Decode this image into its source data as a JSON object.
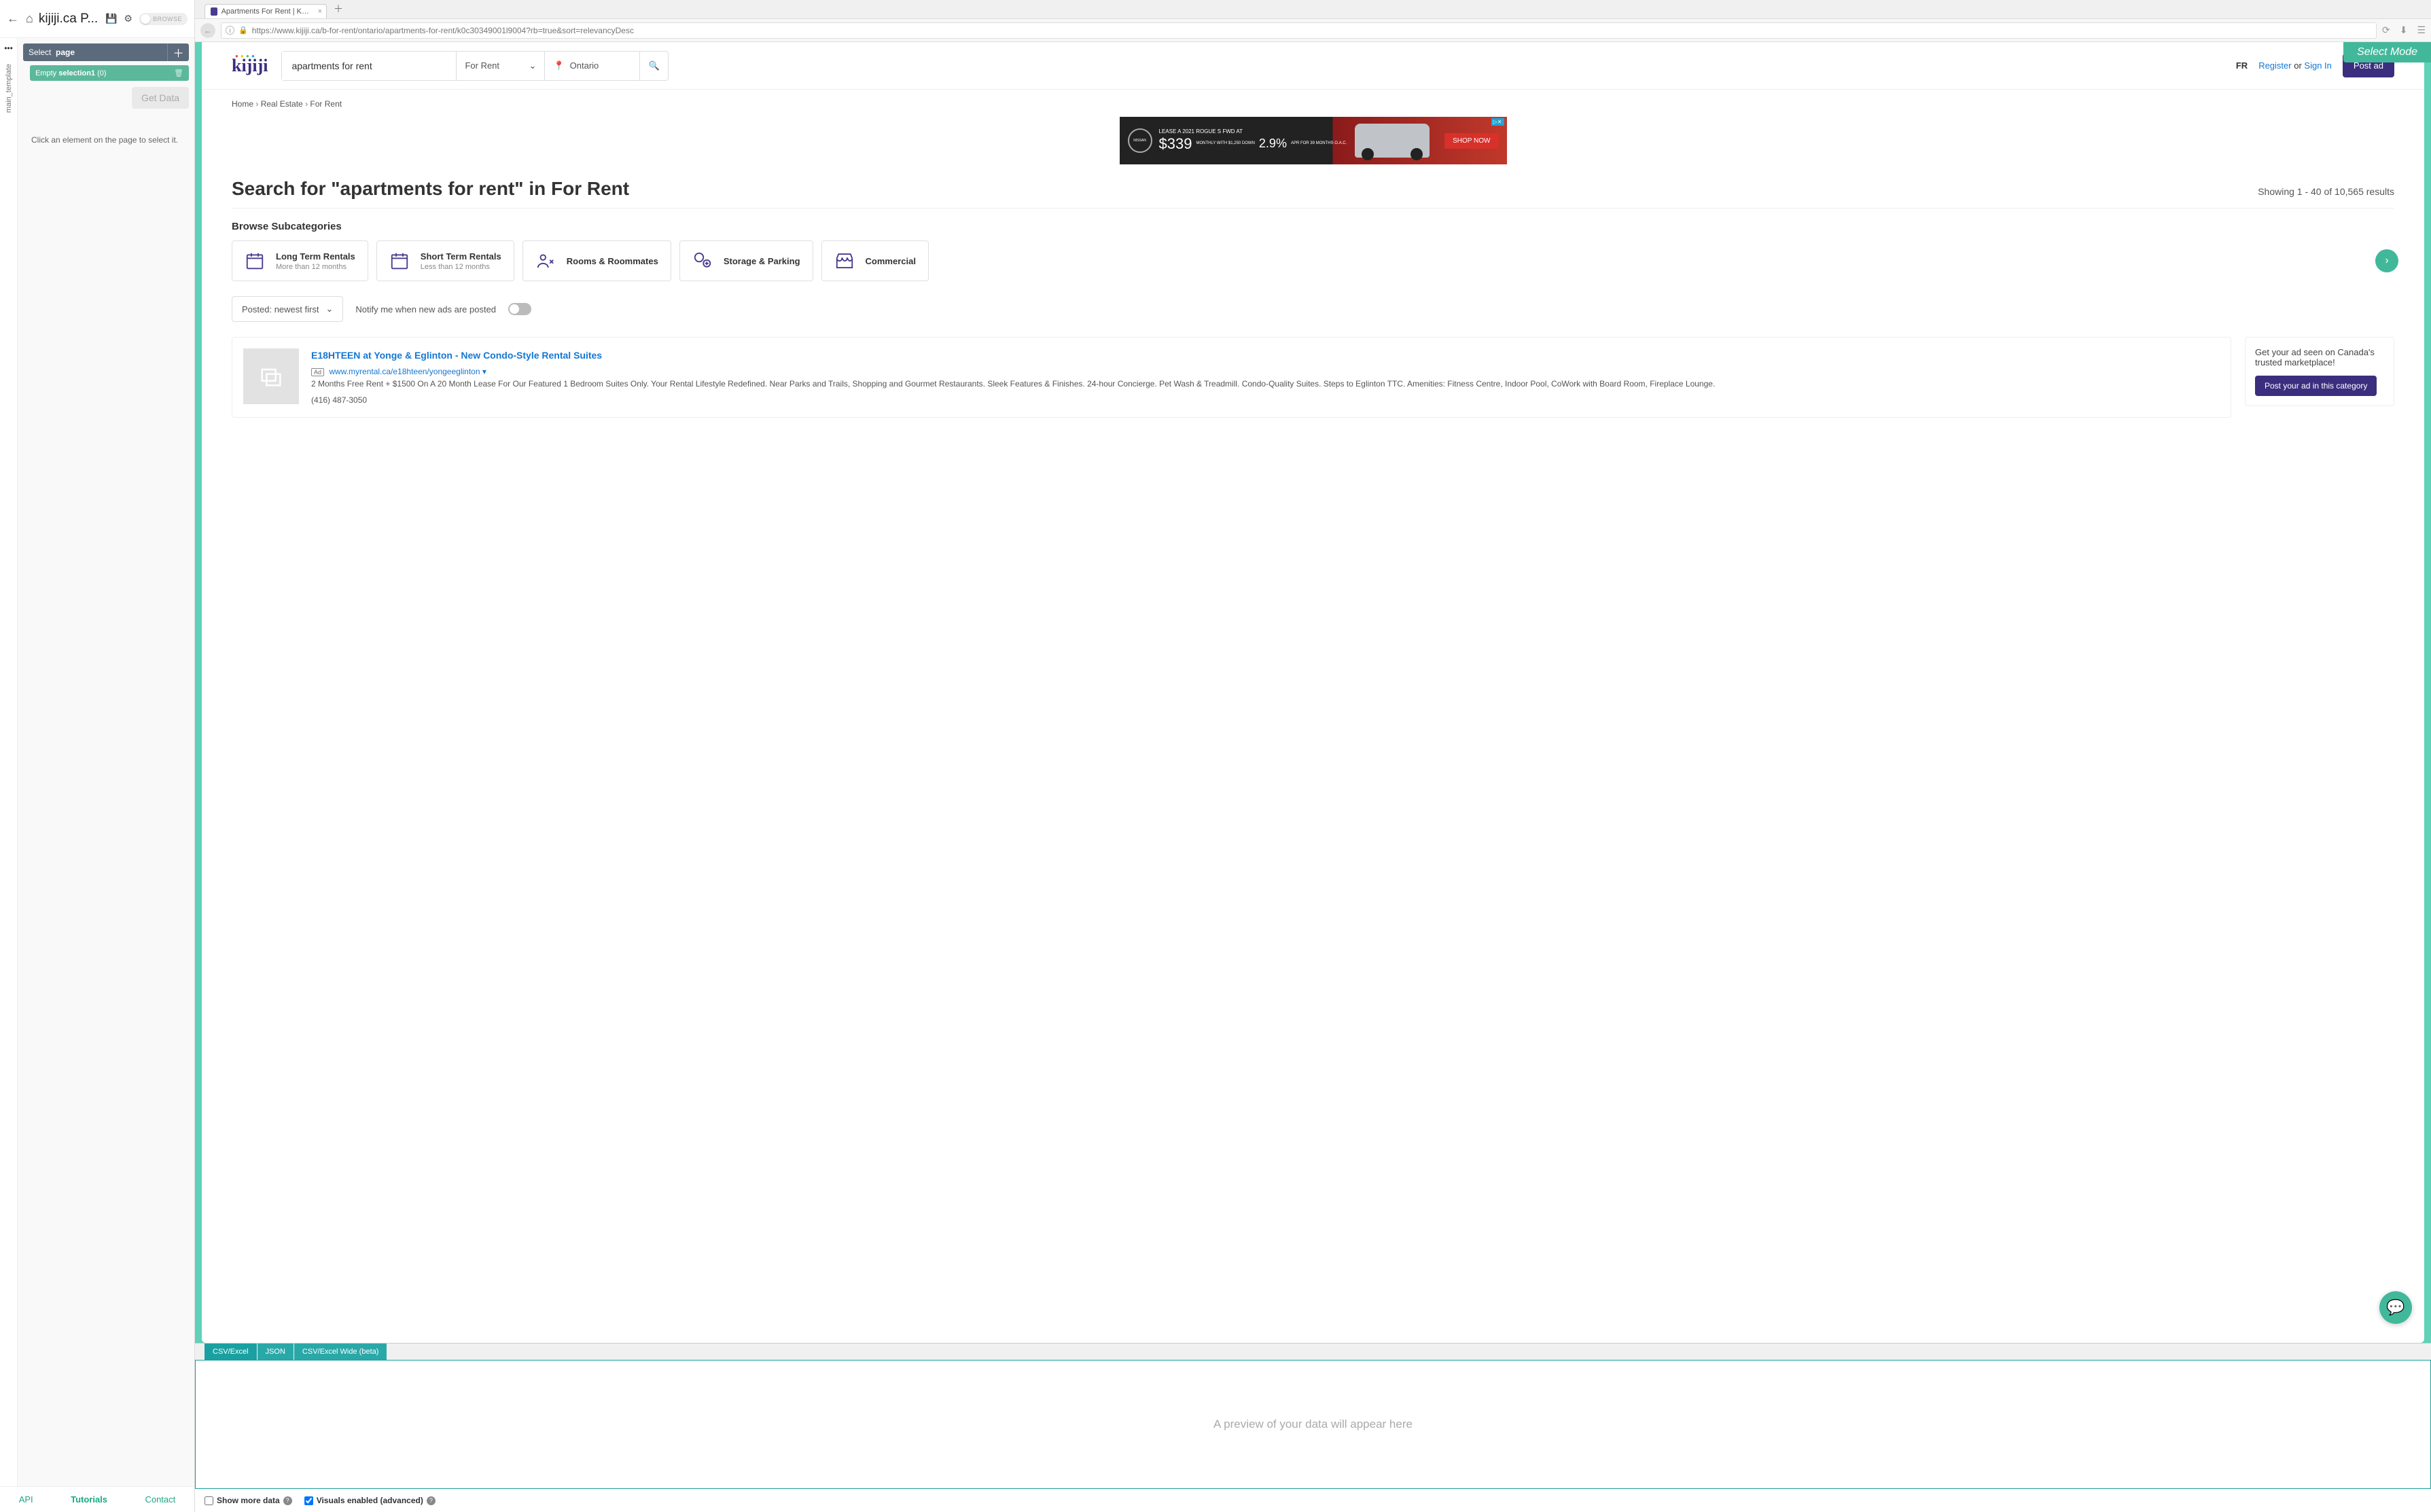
{
  "sidebar": {
    "title": "kijiji.ca P...",
    "browse": "BROWSE",
    "vtab": "main_template",
    "select_label": "Select",
    "select_target": "page",
    "selection_status": "Empty",
    "selection_name": "selection1",
    "selection_count": "(0)",
    "get_data": "Get Data",
    "hint": "Click an element on the page to select it.",
    "footer": {
      "api": "API",
      "tutorials": "Tutorials",
      "contact": "Contact"
    }
  },
  "browser": {
    "tab_title": "Apartments For Rent | Kijiji in Ont",
    "url": "https://www.kijiji.ca/b-for-rent/ontario/apartments-for-rent/k0c30349001l9004?rb=true&sort=relevancyDesc",
    "url_bold": "kijiji.ca"
  },
  "select_mode": "Select Mode",
  "k": {
    "logo": "kijiji",
    "search_value": "apartments for rent",
    "category": "For Rent",
    "location": "Ontario",
    "fr": "FR",
    "register": "Register",
    "or": "or",
    "signin": "Sign In",
    "post_ad": "Post ad"
  },
  "crumbs": [
    "Home",
    "Real Estate",
    "For Rent"
  ],
  "ad": {
    "headline": "LEASE A 2021 ROGUE S FWD AT",
    "price": "$339",
    "terms1": "MONTHLY WITH $1,250 DOWN",
    "rate": "2.9%",
    "terms2": "APR FOR 39 MONTHS O.A.C.",
    "cta": "SHOP NOW",
    "brand": "NISSAN"
  },
  "title": "Search for \"apartments for rent\" in For Rent",
  "results_count": "Showing 1 - 40 of 10,565 results",
  "subcat_heading": "Browse Subcategories",
  "subcats": [
    {
      "t": "Long Term Rentals",
      "s": "More than 12 months"
    },
    {
      "t": "Short Term Rentals",
      "s": "Less than 12 months"
    },
    {
      "t": "Rooms & Roommates",
      "s": ""
    },
    {
      "t": "Storage & Parking",
      "s": ""
    },
    {
      "t": "Commercial",
      "s": ""
    }
  ],
  "sort": "Posted: newest first",
  "notify": "Notify me when new ads are posted",
  "listing": {
    "title": "E18HTEEN at Yonge & Eglinton - New Condo-Style Rental Suites",
    "ad_badge": "Ad",
    "url": "www.myrental.ca/e18hteen/yongeeglinton",
    "desc1": "2 Months Free Rent + $1500 On A 20 Month Lease For Our Featured 1 Bedroom Suites Only. Your Rental Lifestyle Redefined. Near Parks and Trails, Shopping and Gourmet Restaurants. Sleek Features & Finishes. 24-hour Concierge. Pet Wash & Treadmill. Condo-Quality Suites. Steps to Eglinton TTC. Amenities: Fitness Centre, Indoor Pool, CoWork with Board Room, Fireplace Lounge.",
    "phone": "(416) 487-3050"
  },
  "promo": {
    "text": "Get your ad seen on Canada's trusted marketplace!",
    "cta": "Post your ad in this category"
  },
  "data_panel": {
    "tabs": [
      "CSV/Excel",
      "JSON",
      "CSV/Excel Wide (beta)"
    ],
    "placeholder": "A preview of your data will appear here",
    "show_more": "Show more data",
    "visuals": "Visuals enabled (advanced)"
  }
}
